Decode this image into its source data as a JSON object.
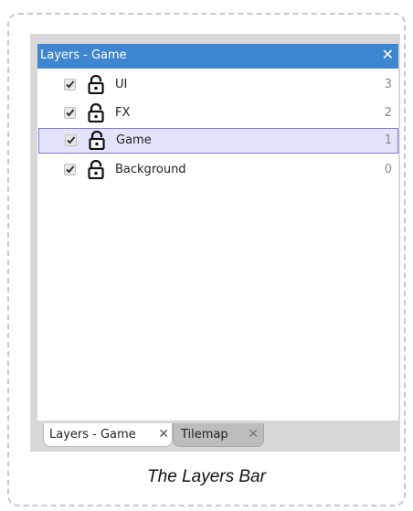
{
  "window": {
    "title": "Layers - Game",
    "close_glyph": "✕"
  },
  "layers": [
    {
      "name": "UI",
      "index": "3",
      "checked": true,
      "locked": false,
      "selected": false
    },
    {
      "name": "FX",
      "index": "2",
      "checked": true,
      "locked": false,
      "selected": false
    },
    {
      "name": "Game",
      "index": "1",
      "checked": true,
      "locked": false,
      "selected": true
    },
    {
      "name": "Background",
      "index": "0",
      "checked": true,
      "locked": false,
      "selected": false
    }
  ],
  "tabs": [
    {
      "label": "Layers - Game",
      "close_glyph": "✕",
      "active": true
    },
    {
      "label": "Tilemap",
      "close_glyph": "✕",
      "active": false
    }
  ],
  "caption": "The Layers Bar",
  "colors": {
    "titlebar": "#3f86d0",
    "selected_row_bg": "#e3e3fb",
    "selected_row_border": "#7d7cd8",
    "panel_bg": "#d8d8d8"
  },
  "icons": {
    "checkbox": "checkmark-icon",
    "lock": "unlocked-padlock-icon",
    "close": "close-icon"
  }
}
